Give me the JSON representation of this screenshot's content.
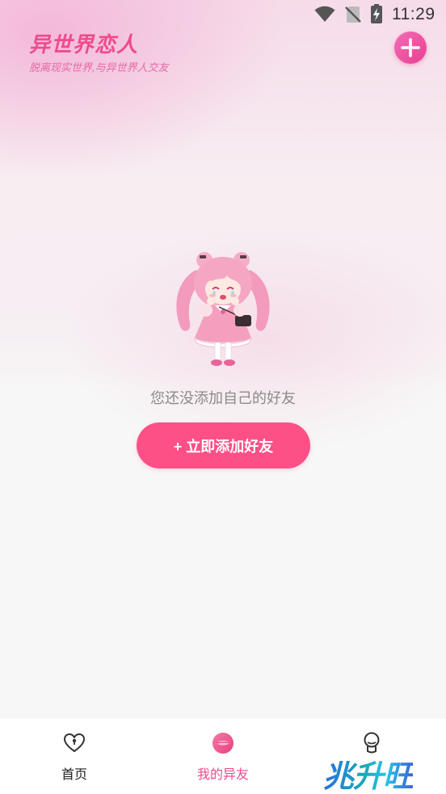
{
  "status_bar": {
    "time": "11:29",
    "icons": [
      "wifi-icon",
      "no-sim-icon",
      "battery-charging-icon"
    ]
  },
  "header": {
    "title": "异世界恋人",
    "subtitle": "脱离现实世界,与异世界人交友",
    "add_button_icon": "plus-icon"
  },
  "empty_state": {
    "illustration": "anime-girl-illustration",
    "message": "您还没添加自己的好友",
    "add_button_label": "+ 立即添加好友"
  },
  "bottom_nav": {
    "items": [
      {
        "label": "首页",
        "icon": "heart-lock-icon",
        "active": false
      },
      {
        "label": "我的异友",
        "icon": "lips-icon",
        "active": true
      },
      {
        "icon": "head-icon",
        "active": false
      }
    ]
  },
  "watermark": {
    "text": "兆升旺"
  },
  "colors": {
    "accent": "#fd5087",
    "title_pink": "#ee4b8b",
    "muted_text": "#8a8a8a",
    "background": "#f7f7f7"
  }
}
